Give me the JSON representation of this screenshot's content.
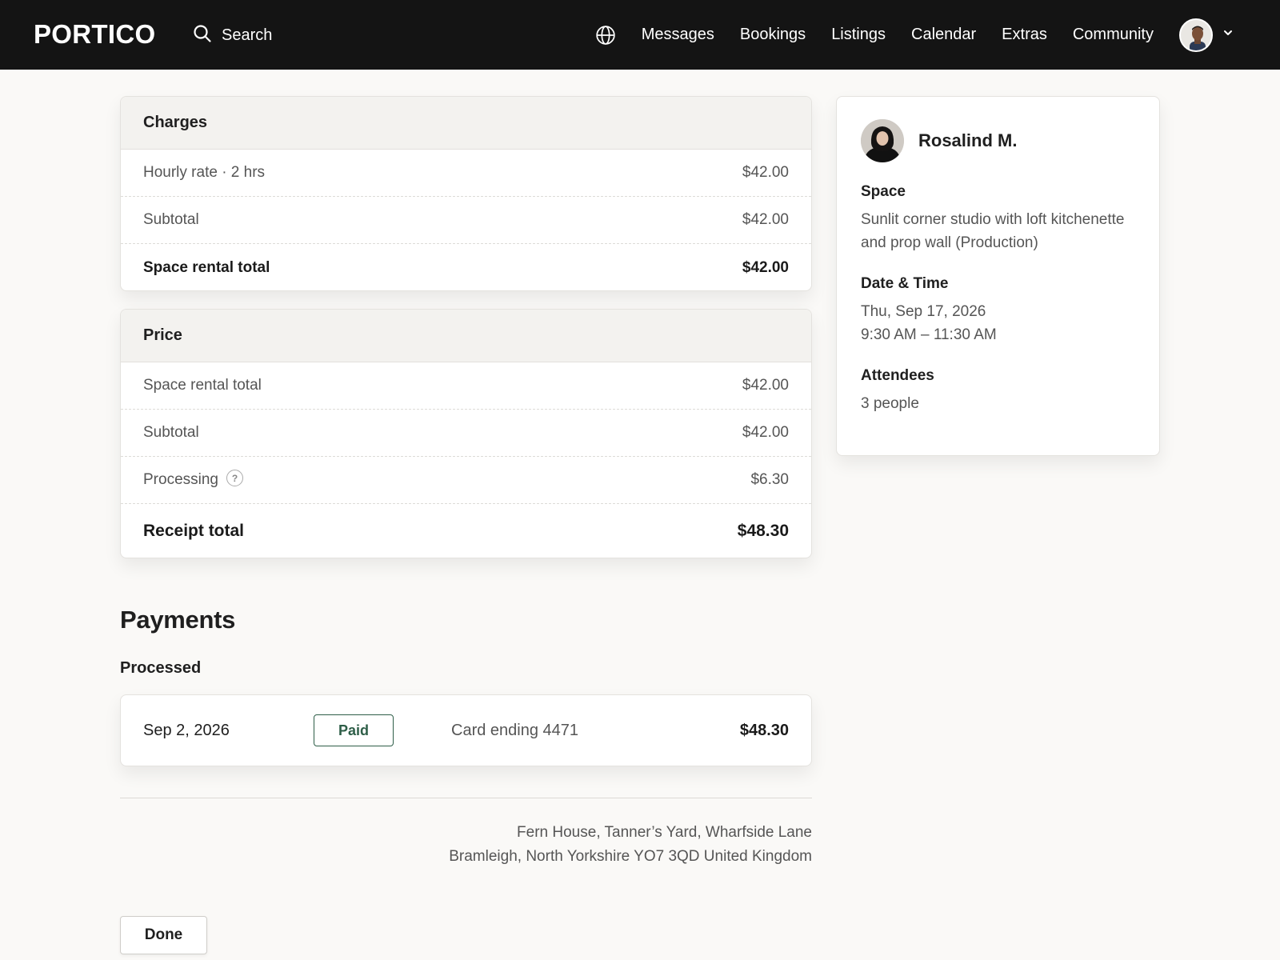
{
  "header": {
    "logo": "PORTICO",
    "search_label": "Search",
    "nav": [
      "Messages",
      "Bookings",
      "Listings",
      "Calendar",
      "Extras",
      "Community"
    ]
  },
  "charges": {
    "title": "Charges",
    "rows": [
      {
        "label": "Hourly rate · 2 hrs",
        "amount": "$42.00"
      },
      {
        "label": "Subtotal",
        "amount": "$42.00"
      },
      {
        "label": "Space rental total",
        "amount": "$42.00"
      }
    ]
  },
  "price": {
    "title": "Price",
    "rows": [
      {
        "label": "Space rental total",
        "amount": "$42.00"
      },
      {
        "label": "Subtotal",
        "amount": "$42.00"
      },
      {
        "label": "Processing",
        "amount": "$6.30",
        "help": "?"
      },
      {
        "label": "Receipt total",
        "amount": "$48.30"
      }
    ]
  },
  "payments": {
    "title": "Payments",
    "section_label": "Processed",
    "items": [
      {
        "date": "Sep 2, 2026",
        "status": "Paid",
        "method": "Card ending 4471",
        "amount": "$48.30"
      }
    ]
  },
  "address": {
    "line1": "Fern House, Tanner’s Yard, Wharfside Lane",
    "line2": "Bramleigh, North Yorkshire YO7 3QD United Kingdom"
  },
  "done_label": "Done",
  "booking": {
    "host_name": "Rosalind M.",
    "space_label": "Space",
    "space_value": "Sunlit corner studio with loft kitchenette and prop wall (Production)",
    "datetime_label": "Date & Time",
    "date_value": "Thu, Sep 17, 2026",
    "time_value": "9:30 AM – 11:30 AM",
    "attendees_label": "Attendees",
    "attendees_value": "3 people"
  },
  "colors": {
    "topbar": "#141414",
    "paid_accent": "#2e5e48",
    "background": "#faf9f7"
  }
}
